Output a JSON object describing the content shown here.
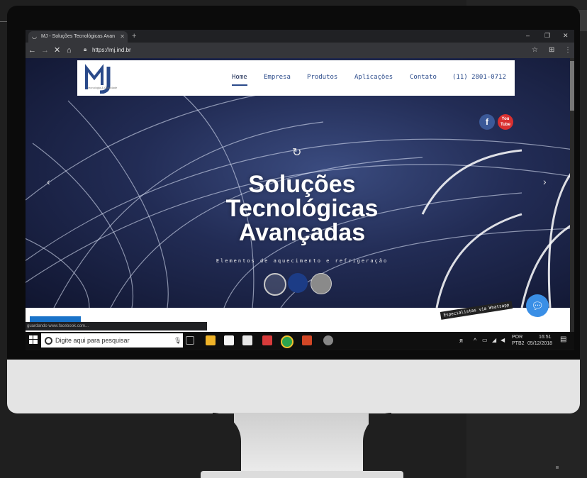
{
  "browser": {
    "tab_title": "MJ - Soluções Tecnológicas Avan",
    "tab_close": "✕",
    "new_tab": "+",
    "url": "https://mj.ind.br",
    "window_controls": [
      "–",
      "❐",
      "✕"
    ]
  },
  "site": {
    "logo_text": "Tecnologia & Qualidade",
    "menu": [
      "Home",
      "Empresa",
      "Produtos",
      "Aplicações",
      "Contato"
    ],
    "phone": "(11) 2801-0712",
    "social": [
      "f",
      "You Tube"
    ],
    "hero_title": [
      "Soluções",
      "Tecnológicas",
      "Avançadas"
    ],
    "hero_subtitle": "Elementos de aquecimento e refrigeração",
    "whatsapp_label": "Especialistas via Whatsapp",
    "status_text": "guardando www.facebook.com..."
  },
  "taskbar": {
    "search_placeholder": "Digite aqui para pesquisar",
    "lang_top": "POR",
    "lang_bottom": "PTB2",
    "time": "16:51",
    "date": "05/12/2018"
  },
  "colors": {
    "brand_blue": "#2a4a8a",
    "facebook": "#3b5998",
    "youtube": "#d93030",
    "whatsapp_bubble": "#3a8fe6"
  }
}
